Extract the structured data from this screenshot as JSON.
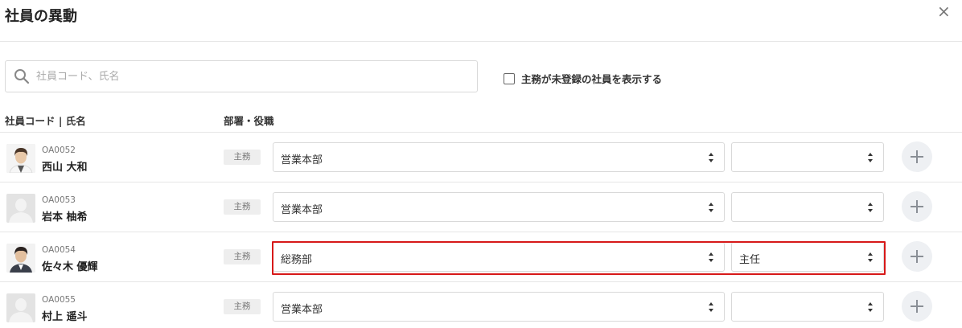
{
  "dialog": {
    "title": "社員の異動",
    "close_icon": "×"
  },
  "search": {
    "placeholder": "社員コード、氏名",
    "value": ""
  },
  "filter": {
    "checkbox_label": "主務が未登録の社員を表示する",
    "checked": false
  },
  "columns": {
    "employee": "社員コード | 氏名",
    "dept_role": "部署・役職"
  },
  "rows": [
    {
      "code": "OA0052",
      "name": "西山 大和",
      "badge": "主務",
      "department": "営業本部",
      "role": "",
      "avatar": "photo"
    },
    {
      "code": "OA0053",
      "name": "岩本 柚希",
      "badge": "主務",
      "department": "営業本部",
      "role": "",
      "avatar": "placeholder"
    },
    {
      "code": "OA0054",
      "name": "佐々木 優輝",
      "badge": "主務",
      "department": "総務部",
      "role": "主任",
      "avatar": "photo"
    },
    {
      "code": "OA0055",
      "name": "村上 遥斗",
      "badge": "主務",
      "department": "営業本部",
      "role": "",
      "avatar": "placeholder"
    }
  ],
  "highlight_color": "#d71919"
}
